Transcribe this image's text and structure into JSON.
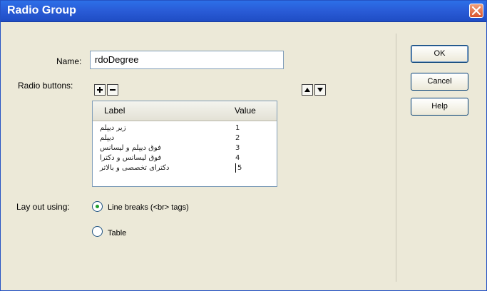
{
  "window": {
    "title": "Radio Group"
  },
  "form": {
    "name_label": "Name:",
    "name_value": "rdoDegree",
    "radio_buttons_label": "Radio buttons:",
    "columns": [
      "Label",
      "Value"
    ],
    "rows": [
      {
        "label": "زیر دیپلم",
        "value": "1"
      },
      {
        "label": "دیپلم",
        "value": "2"
      },
      {
        "label": "فوق دیپلم و لیسانس",
        "value": "3"
      },
      {
        "label": "فوق لیسانس و دکترا",
        "value": "4"
      },
      {
        "label": "دکترای تخصصی و بالاتر",
        "value": "5"
      }
    ],
    "layout_label": "Lay out using:",
    "layout_options": [
      {
        "label": "Line breaks (<br> tags)",
        "selected": true
      },
      {
        "label": "Table",
        "selected": false
      }
    ]
  },
  "buttons": {
    "ok": "OK",
    "cancel": "Cancel",
    "help": "Help"
  },
  "icons": {
    "add": "plus-icon",
    "remove": "minus-icon",
    "up": "arrow-up-icon",
    "down": "arrow-down-icon",
    "close": "close-icon"
  }
}
